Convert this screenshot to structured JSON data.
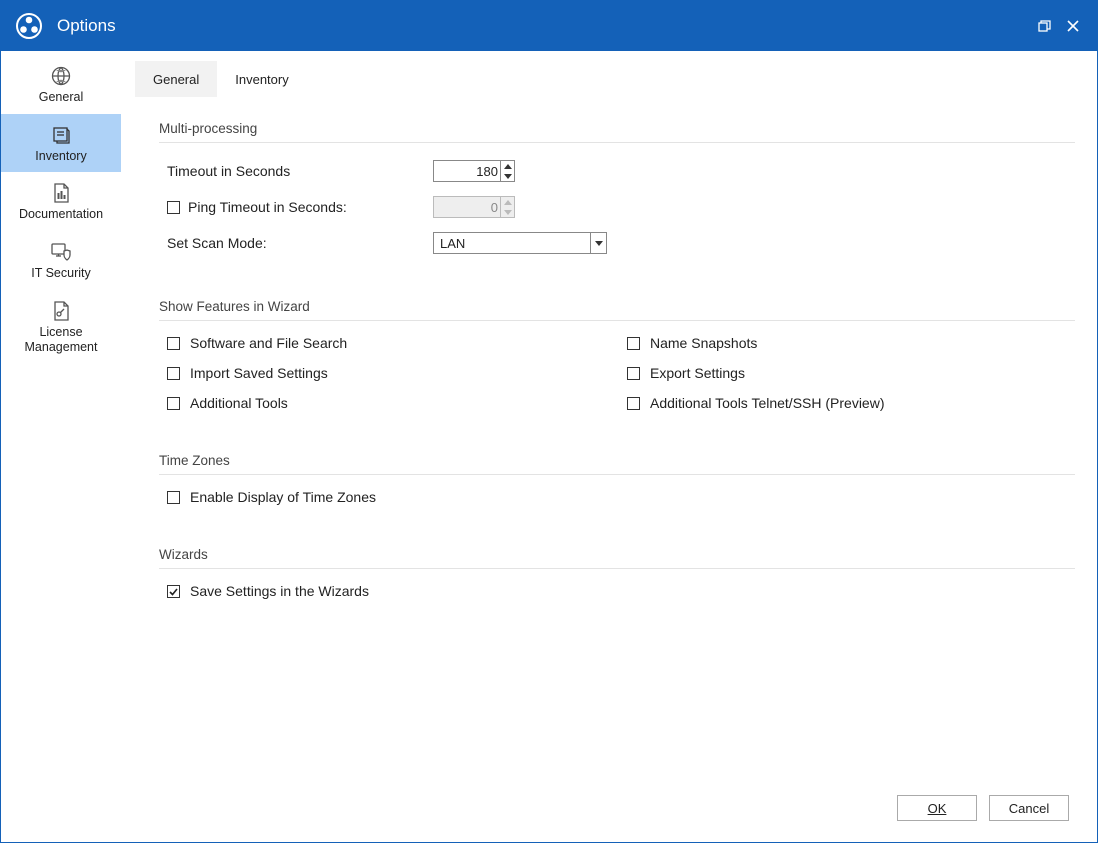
{
  "window": {
    "title": "Options"
  },
  "sidebar": {
    "items": [
      {
        "label": "General"
      },
      {
        "label": "Inventory"
      },
      {
        "label": "Documentation"
      },
      {
        "label": "IT Security"
      },
      {
        "label": "License\nManagement"
      }
    ],
    "selected_index": 1
  },
  "tabs": {
    "items": [
      {
        "label": "General"
      },
      {
        "label": "Inventory"
      }
    ],
    "active_index": 0
  },
  "sections": {
    "multi_processing": {
      "title": "Multi-processing",
      "timeout_label": "Timeout in Seconds",
      "timeout_value": "180",
      "ping_timeout_label": "Ping Timeout in Seconds:",
      "ping_timeout_checked": false,
      "ping_timeout_value": "0",
      "scan_mode_label": "Set Scan Mode:",
      "scan_mode_value": "LAN"
    },
    "wizard_features": {
      "title": "Show Features in Wizard",
      "items": [
        {
          "label": "Software and File Search",
          "checked": false
        },
        {
          "label": "Name Snapshots",
          "checked": false
        },
        {
          "label": "Import Saved Settings",
          "checked": false
        },
        {
          "label": "Export Settings",
          "checked": false
        },
        {
          "label": "Additional Tools",
          "checked": false
        },
        {
          "label": "Additional Tools Telnet/SSH (Preview)",
          "checked": false
        }
      ]
    },
    "time_zones": {
      "title": "Time Zones",
      "enable_label": "Enable Display of Time Zones",
      "enable_checked": false
    },
    "wizards": {
      "title": "Wizards",
      "save_label": "Save Settings in the Wizards",
      "save_checked": true
    }
  },
  "footer": {
    "ok_label": "OK",
    "cancel_label": "Cancel"
  }
}
